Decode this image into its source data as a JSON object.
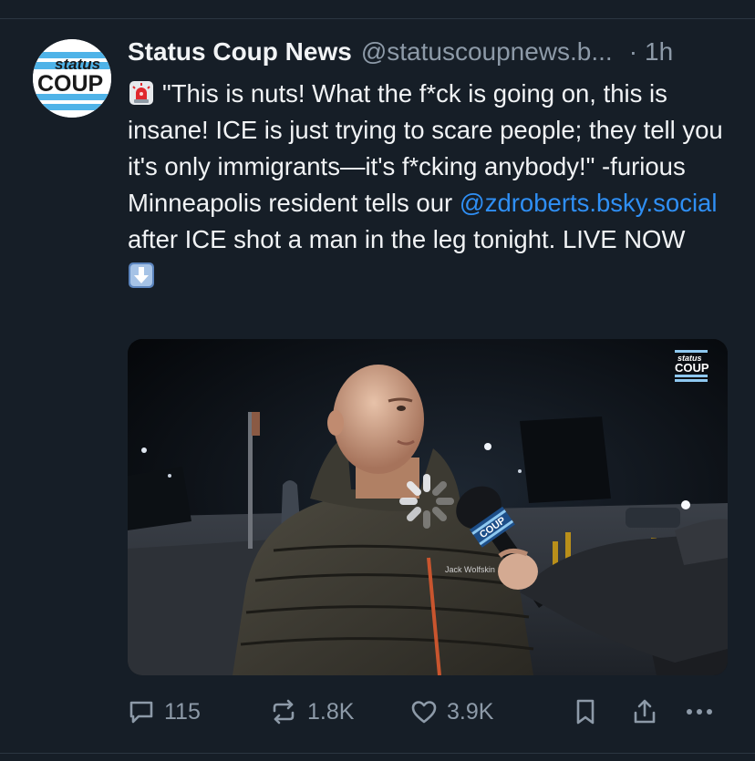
{
  "post": {
    "author": {
      "display_name": "Status Coup News",
      "handle": "@statuscoupnews.b...",
      "avatar_text_top": "status",
      "avatar_text_bottom": "COUP"
    },
    "time_separator": "·",
    "time": "1h",
    "body": {
      "emoji_start": "siren-emoji",
      "text_before_mention": "\"This is nuts! What the f*ck is going on, this is insane! ICE is just trying to scare people; they tell you it's only immigrants—it's f*cking anybody!\" -furious Minneapolis resident tells our ",
      "mention": "@zdroberts.bsky.social",
      "text_after_mention": " after ICE shot a man in the leg tonight. LIVE NOW",
      "emoji_end": "down-arrow-emoji"
    },
    "media": {
      "watermark_top": "status",
      "watermark_bottom": "COUP",
      "mic_label": "COUP",
      "jacket_logo": "Jack Wolfskin"
    },
    "actions": {
      "replies": "115",
      "reposts": "1.8K",
      "likes": "3.9K"
    }
  },
  "colors": {
    "background": "#161e27",
    "text": "#f1f3f5",
    "muted": "#8d9aa8",
    "link": "#2f8ff5",
    "divider": "#2b3641"
  },
  "icons": [
    "reply-icon",
    "repost-icon",
    "like-icon",
    "bookmark-icon",
    "share-icon",
    "more-icon"
  ]
}
